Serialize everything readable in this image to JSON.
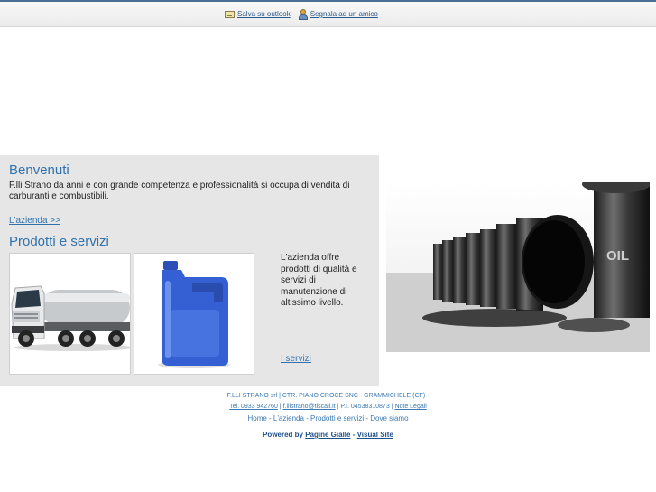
{
  "toolbar": {
    "outlook_label": "Salva su outlook",
    "friend_label": "Segnala ad un amico"
  },
  "welcome": {
    "title": "Benvenuti",
    "text": "F.lli Strano da anni e con grande competenza e professionalità si occupa di vendita di carburanti e combustibili.",
    "link": "L'azienda >>"
  },
  "products": {
    "title": "Prodotti e servizi",
    "description": "L'azienda offre prodotti di qualità e servizi di manutenzione di altissimo livello.",
    "link": "I servizi"
  },
  "oil_image": {
    "barrel_label": "OIL"
  },
  "footer": {
    "company_line": "F.LLI STRANO srl | CTR. PIANO CROCE SNC - GRAMMICHELE (CT) -",
    "tel": "Tel. 0933 942760",
    "sep1": " | ",
    "email": "f.llistrano@tiscali.it",
    "piva": " | P.I. 04538310873 | ",
    "legal": "Note Legali",
    "nav": [
      {
        "label": "Home",
        "link": false
      },
      {
        "label": "L'azienda",
        "link": true
      },
      {
        "label": "Prodotti e servizi",
        "link": true
      },
      {
        "label": "Dove siamo",
        "link": true
      }
    ],
    "nav_sep": " - ",
    "powered_prefix": "Powered by ",
    "pagine_gialle": "Pagine Gialle",
    "powered_sep": " - ",
    "visual_site": "Visual Site"
  },
  "colors": {
    "accent": "#2f72ad",
    "panel": "#e6e6e6",
    "footer_text": "#3a79b4"
  }
}
